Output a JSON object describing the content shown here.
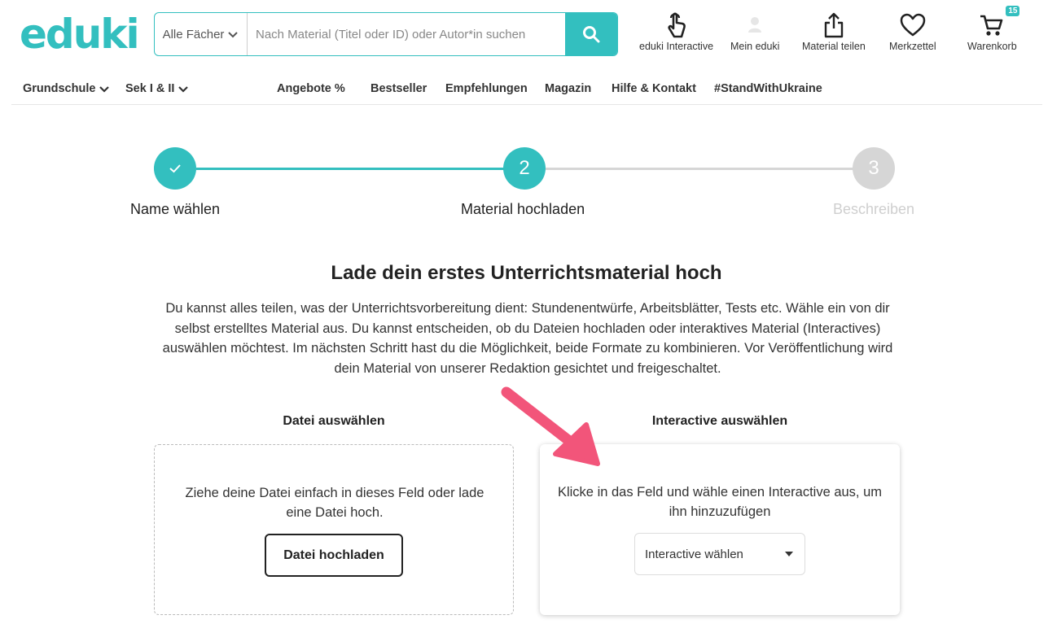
{
  "header": {
    "logo": "eduki",
    "search": {
      "category_label": "Alle Fächer",
      "placeholder": "Nach Material (Titel oder ID) oder Autor*in suchen"
    },
    "icons": [
      {
        "label": "eduki Interactive",
        "icon": "hand-pointer-icon"
      },
      {
        "label": "Mein eduki",
        "icon": "user-icon"
      },
      {
        "label": "Material teilen",
        "icon": "share-icon"
      },
      {
        "label": "Merkzettel",
        "icon": "heart-icon"
      },
      {
        "label": "Warenkorb",
        "icon": "cart-icon",
        "badge": "15"
      }
    ]
  },
  "nav": {
    "grundschule": "Grundschule",
    "sek": "Sek I & II",
    "angebote": "Angebote %",
    "bestseller": "Bestseller",
    "empfehlungen": "Empfehlungen",
    "magazin": "Magazin",
    "hilfe": "Hilfe & Kontakt",
    "ukraine": "#StandWithUkraine"
  },
  "stepper": {
    "steps": [
      {
        "label": "Name wählen",
        "number": "",
        "status": "done"
      },
      {
        "label": "Material hochladen",
        "number": "2",
        "status": "active"
      },
      {
        "label": "Beschreiben",
        "number": "3",
        "status": "upcoming"
      }
    ]
  },
  "main": {
    "title": "Lade dein erstes Unterrichtsmaterial hoch",
    "intro": "Du kannst alles teilen, was der Unterrichtsvorbereitung dient: Stundenentwürfe, Arbeitsblätter, Tests etc. Wähle ein von dir selbst erstelltes Material aus. Du kannst entscheiden, ob du Dateien hochladen oder interaktives Material (Interactives) auswählen möchtest. Im nächsten Schritt hast du die Möglichkeit, beide Formate zu kombinieren. Vor Veröffentlichung wird dein Material von unserer Redaktion gesichtet und freigeschaltet.",
    "file": {
      "heading": "Datei auswählen",
      "text": "Ziehe deine Datei einfach in dieses Feld oder lade eine Datei hoch.",
      "button": "Datei hochladen"
    },
    "interactive": {
      "heading": "Interactive auswählen",
      "text": "Klicke in das Feld und wähle einen Interactive aus, um ihn hinzuzufügen",
      "select_value": "Interactive wählen"
    }
  },
  "colors": {
    "accent": "#33bfbf",
    "inactive": "#cfcfcf",
    "arrow": "#f2557a"
  }
}
